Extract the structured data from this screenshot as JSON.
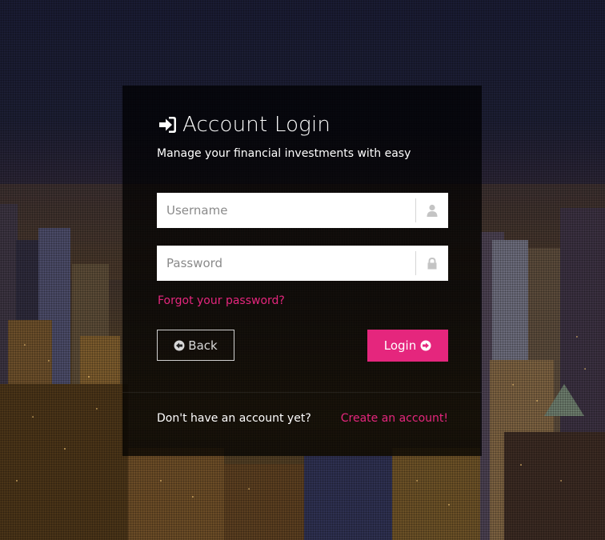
{
  "login": {
    "title": "Account Login",
    "subtitle": "Manage your financial investments with easy",
    "username_placeholder": "Username",
    "password_placeholder": "Password",
    "forgot_link": "Forgot your password?",
    "back_label": "Back",
    "login_label": "Login",
    "no_account_text": "Don't have an account yet?",
    "create_link": "Create an account!"
  },
  "icons": {
    "title": "sign-in-icon",
    "username": "user-icon",
    "password": "lock-icon",
    "back": "circle-arrow-left-icon",
    "login": "circle-arrow-right-icon"
  },
  "colors": {
    "accent": "#e5267d",
    "panel": "rgba(0,0,0,0.72)",
    "text": "#ffffff"
  }
}
